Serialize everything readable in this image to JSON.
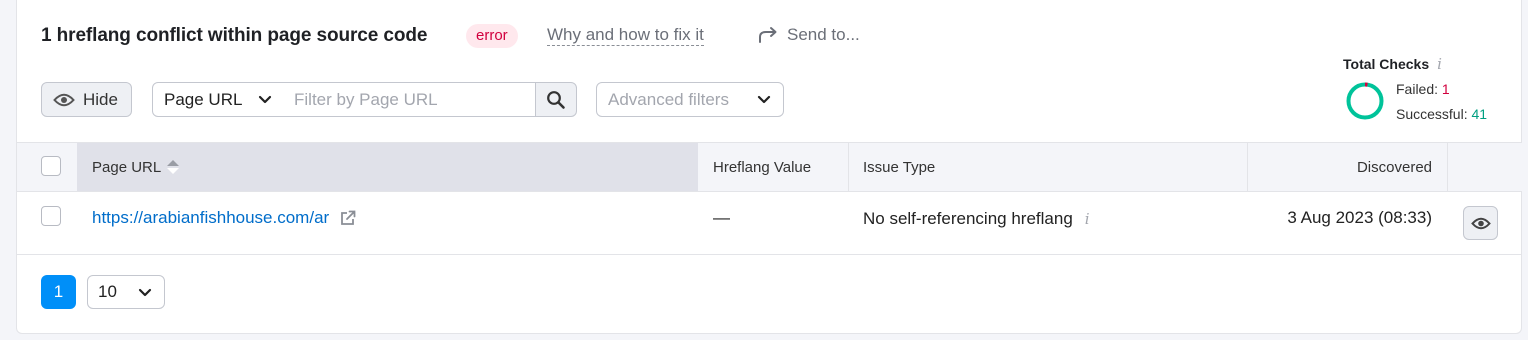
{
  "header": {
    "title": "1 hreflang conflict within page source code",
    "badge": "error",
    "fix_link": "Why and how to fix it",
    "send_to": "Send to..."
  },
  "filters": {
    "hide_label": "Hide",
    "column_select": "Page URL",
    "input_placeholder": "Filter by Page URL",
    "input_value": "",
    "advanced_label": "Advanced filters"
  },
  "total_checks": {
    "title": "Total Checks",
    "info_glyph": "i",
    "failed_label": "Failed:",
    "failed_count": "1",
    "successful_label": "Successful:",
    "successful_count": "41",
    "failed_value": 1,
    "successful_value": 41
  },
  "table": {
    "headers": {
      "page_url": "Page URL",
      "hreflang_value": "Hreflang Value",
      "issue_type": "Issue Type",
      "discovered": "Discovered"
    },
    "rows": [
      {
        "page_url": "https://arabianfishhouse.com/ar",
        "hreflang_value": "—",
        "issue_type": "No self-referencing hreflang",
        "discovered": "3 Aug 2023 (08:33)"
      }
    ]
  },
  "pagination": {
    "current_page": "1",
    "page_size": "10"
  },
  "colors": {
    "accent_blue": "#008ff8",
    "link_blue": "#006dca",
    "error_red": "#d1003e",
    "success_green": "#009f81"
  },
  "icons": [
    "eye-icon",
    "chevron-down-icon",
    "search-icon",
    "share-arrow-icon",
    "external-link-icon",
    "info-icon",
    "sort-arrows-icon"
  ]
}
